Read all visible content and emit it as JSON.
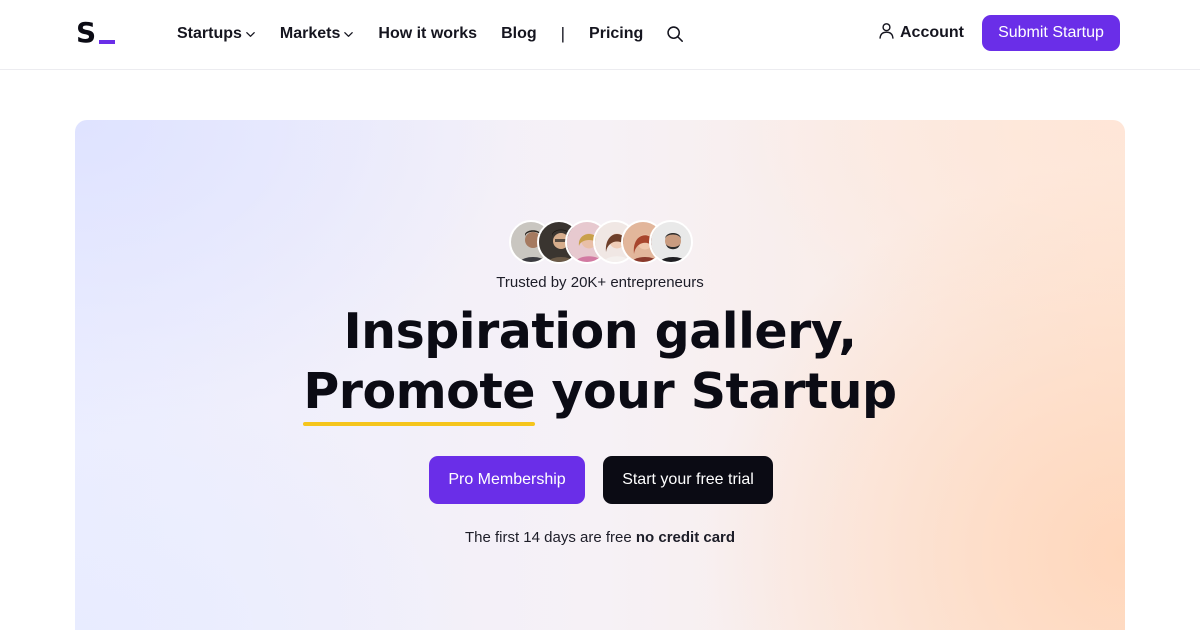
{
  "header": {
    "logo_text": "S",
    "nav": [
      {
        "label": "Startups",
        "has_dropdown": true
      },
      {
        "label": "Markets",
        "has_dropdown": true
      },
      {
        "label": "How it works",
        "has_dropdown": false
      },
      {
        "label": "Blog",
        "has_dropdown": false
      }
    ],
    "separator": "|",
    "pricing_label": "Pricing",
    "search_icon": "search-icon",
    "account_label": "Account",
    "account_icon": "user-icon",
    "submit_label": "Submit Startup"
  },
  "hero": {
    "avatar_count": 6,
    "trusted_text": "Trusted by 20K+ entrepreneurs",
    "headline_line1": "Inspiration gallery,",
    "headline_highlight": "Promote",
    "headline_line2_rest": " your Startup",
    "primary_button": "Pro Membership",
    "secondary_button": "Start your free trial",
    "note_prefix": "The first 14 days are free ",
    "note_bold": "no credit card"
  },
  "colors": {
    "accent": "#6a2ee8",
    "dark": "#0b0b14",
    "highlight": "#f5c51c"
  }
}
